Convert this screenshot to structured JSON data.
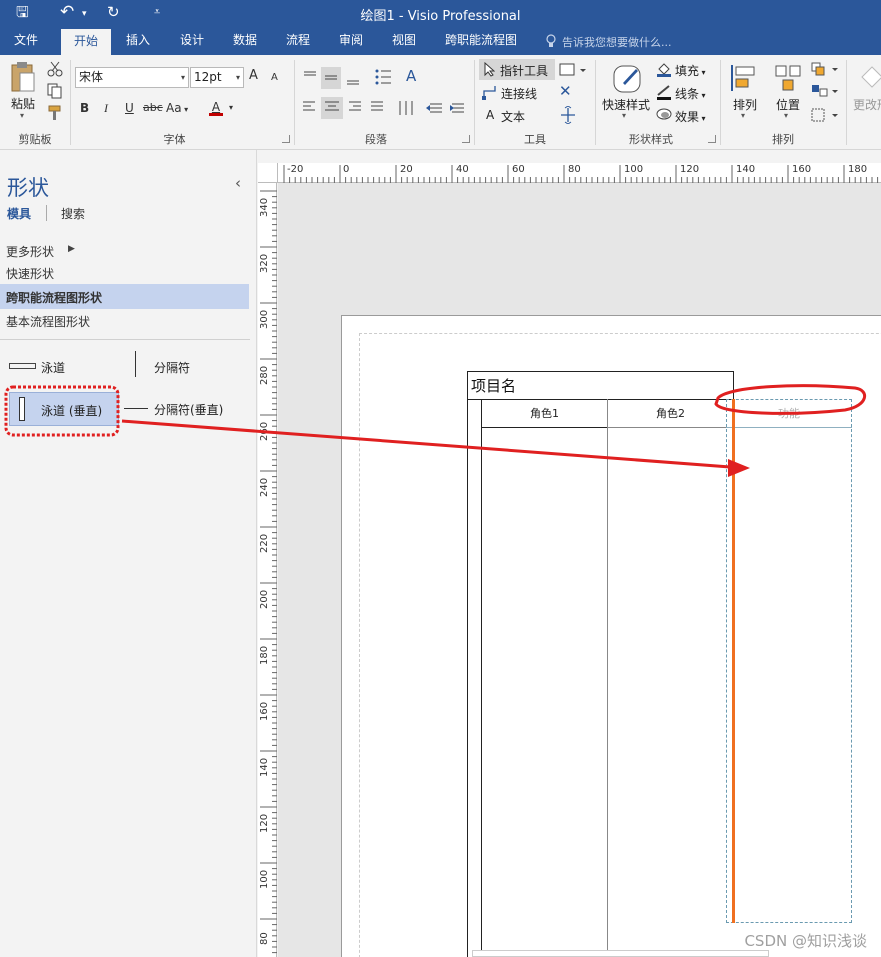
{
  "window": {
    "title": "绘图1 - Visio Professional",
    "quick_access": {
      "save_glyph": "🖫",
      "undo_glyph": "↶",
      "undo_dd_glyph": "▾",
      "redo_glyph": "↻",
      "customize_glyph": "⩡"
    }
  },
  "tabs": [
    {
      "label": "文件"
    },
    {
      "label": "开始",
      "active": true
    },
    {
      "label": "插入"
    },
    {
      "label": "设计"
    },
    {
      "label": "数据"
    },
    {
      "label": "流程"
    },
    {
      "label": "审阅"
    },
    {
      "label": "视图"
    },
    {
      "label": "跨职能流程图"
    }
  ],
  "tell_me": {
    "icon": "lightbulb-icon",
    "text": "告诉我您想要做什么..."
  },
  "ribbon": {
    "clipboard": {
      "paste": "粘贴",
      "label": "剪贴板"
    },
    "font": {
      "face": "宋体",
      "size": "12pt",
      "grow": "A",
      "shrink": "A",
      "bold": "B",
      "italic": "I",
      "underline": "U",
      "strike": "abc",
      "case": "Aa",
      "color_letter": "A",
      "color": "#c00000",
      "label": "字体"
    },
    "paragraph": {
      "label": "段落"
    },
    "tools": {
      "pointer": "指针工具",
      "connector": "连接线",
      "text_icon": "A",
      "text": "文本",
      "label": "工具"
    },
    "shape_style": {
      "quick": "快速样式",
      "fill": "填充",
      "line": "线条",
      "effect": "效果",
      "label": "形状样式"
    },
    "arrange": {
      "arrange": "排列",
      "position": "位置",
      "label": "排列"
    },
    "editing": {
      "change": "更改形"
    }
  },
  "shapes_panel": {
    "title": "形状",
    "collapse_glyph": "‹",
    "tabs": [
      "模具",
      "搜索"
    ],
    "nav": [
      {
        "label": "更多形状",
        "arrow": "▶"
      },
      {
        "label": "快速形状"
      },
      {
        "label": "跨职能流程图形状",
        "selected": true
      },
      {
        "label": "基本流程图形状"
      }
    ],
    "stencils": [
      {
        "label": "泳道"
      },
      {
        "label": "分隔符"
      },
      {
        "label": "泳道 (垂直)",
        "highlighted": true
      },
      {
        "label": "分隔符(垂直)"
      }
    ]
  },
  "ruler": {
    "h_ticks": [
      "-20",
      "0",
      "20",
      "40",
      "60",
      "80",
      "100",
      "120",
      "140",
      "160",
      "180"
    ],
    "v_ticks": [
      "340",
      "320",
      "300",
      "280",
      "260",
      "240",
      "220",
      "200",
      "180",
      "160",
      "140",
      "120",
      "100",
      "80"
    ]
  },
  "diagram": {
    "pool_title": "项目名",
    "lanes": [
      "角色1",
      "角色2",
      "功能"
    ]
  },
  "annotation": {
    "color": "#e02020"
  },
  "watermark": "CSDN @知识浅谈"
}
